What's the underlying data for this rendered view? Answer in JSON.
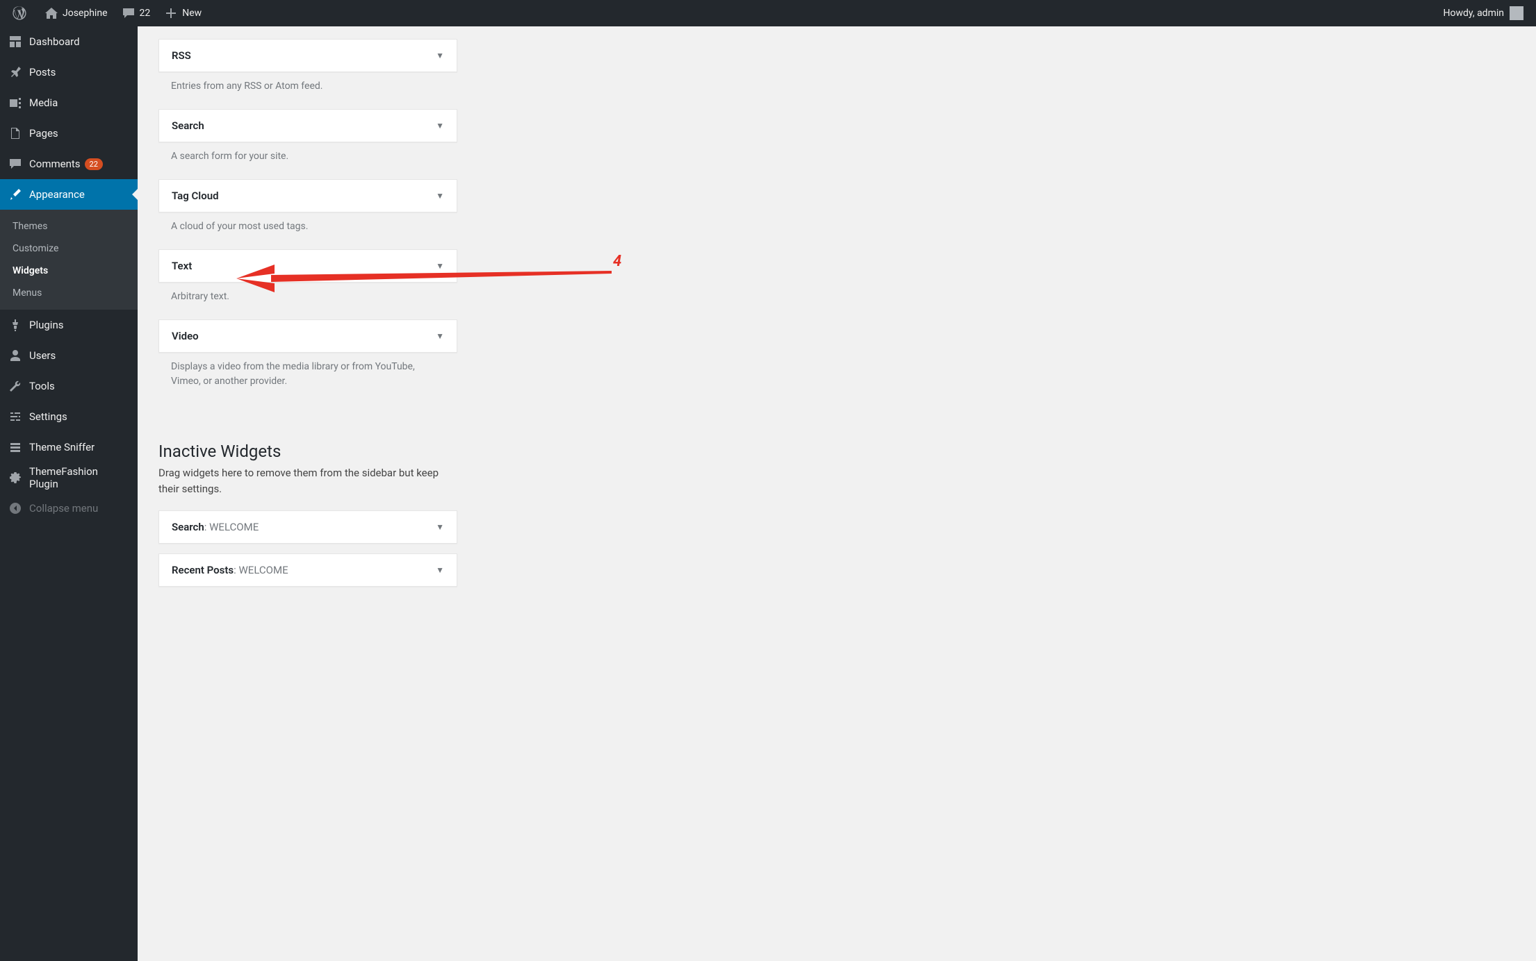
{
  "adminbar": {
    "site_name": "Josephine",
    "comments_count": "22",
    "new_label": "New",
    "howdy_prefix": "Howdy, ",
    "user": "admin"
  },
  "sidebar": {
    "items": [
      {
        "id": "dashboard",
        "label": "Dashboard",
        "icon": "dashboard"
      },
      {
        "id": "posts",
        "label": "Posts",
        "icon": "pin"
      },
      {
        "id": "media",
        "label": "Media",
        "icon": "media"
      },
      {
        "id": "pages",
        "label": "Pages",
        "icon": "pages"
      },
      {
        "id": "comments",
        "label": "Comments",
        "icon": "comment",
        "count": "22"
      },
      {
        "id": "appearance",
        "label": "Appearance",
        "icon": "brush",
        "current": true,
        "submenu": [
          {
            "id": "themes",
            "label": "Themes"
          },
          {
            "id": "customize",
            "label": "Customize"
          },
          {
            "id": "widgets",
            "label": "Widgets",
            "current": true
          },
          {
            "id": "menus",
            "label": "Menus"
          }
        ]
      },
      {
        "id": "plugins",
        "label": "Plugins",
        "icon": "plug"
      },
      {
        "id": "users",
        "label": "Users",
        "icon": "user"
      },
      {
        "id": "tools",
        "label": "Tools",
        "icon": "wrench"
      },
      {
        "id": "settings",
        "label": "Settings",
        "icon": "sliders"
      },
      {
        "id": "theme-sniffer",
        "label": "Theme Sniffer",
        "icon": "list"
      },
      {
        "id": "themefashion-plugin",
        "label": "ThemeFashion Plugin",
        "icon": "gear"
      }
    ],
    "collapse_label": "Collapse menu"
  },
  "widgets": {
    "available": [
      {
        "id": "rss",
        "title": "RSS",
        "desc": "Entries from any RSS or Atom feed."
      },
      {
        "id": "search",
        "title": "Search",
        "desc": "A search form for your site."
      },
      {
        "id": "tag-cloud",
        "title": "Tag Cloud",
        "desc": "A cloud of your most used tags."
      },
      {
        "id": "text",
        "title": "Text",
        "desc": "Arbitrary text."
      },
      {
        "id": "video",
        "title": "Video",
        "desc": "Displays a video from the media library or from You­Tube, Vimeo, or another provider."
      }
    ],
    "inactive_heading": "Inactive Widgets",
    "inactive_desc": "Drag widgets here to remove them from the sidebar but keep their settings.",
    "inactive": [
      {
        "id": "inactive-search",
        "name": "Search",
        "value": "WELCOME"
      },
      {
        "id": "inactive-recent-posts",
        "name": "Recent Posts",
        "value": "WELCOME"
      }
    ]
  },
  "annotation": {
    "label": "4"
  }
}
